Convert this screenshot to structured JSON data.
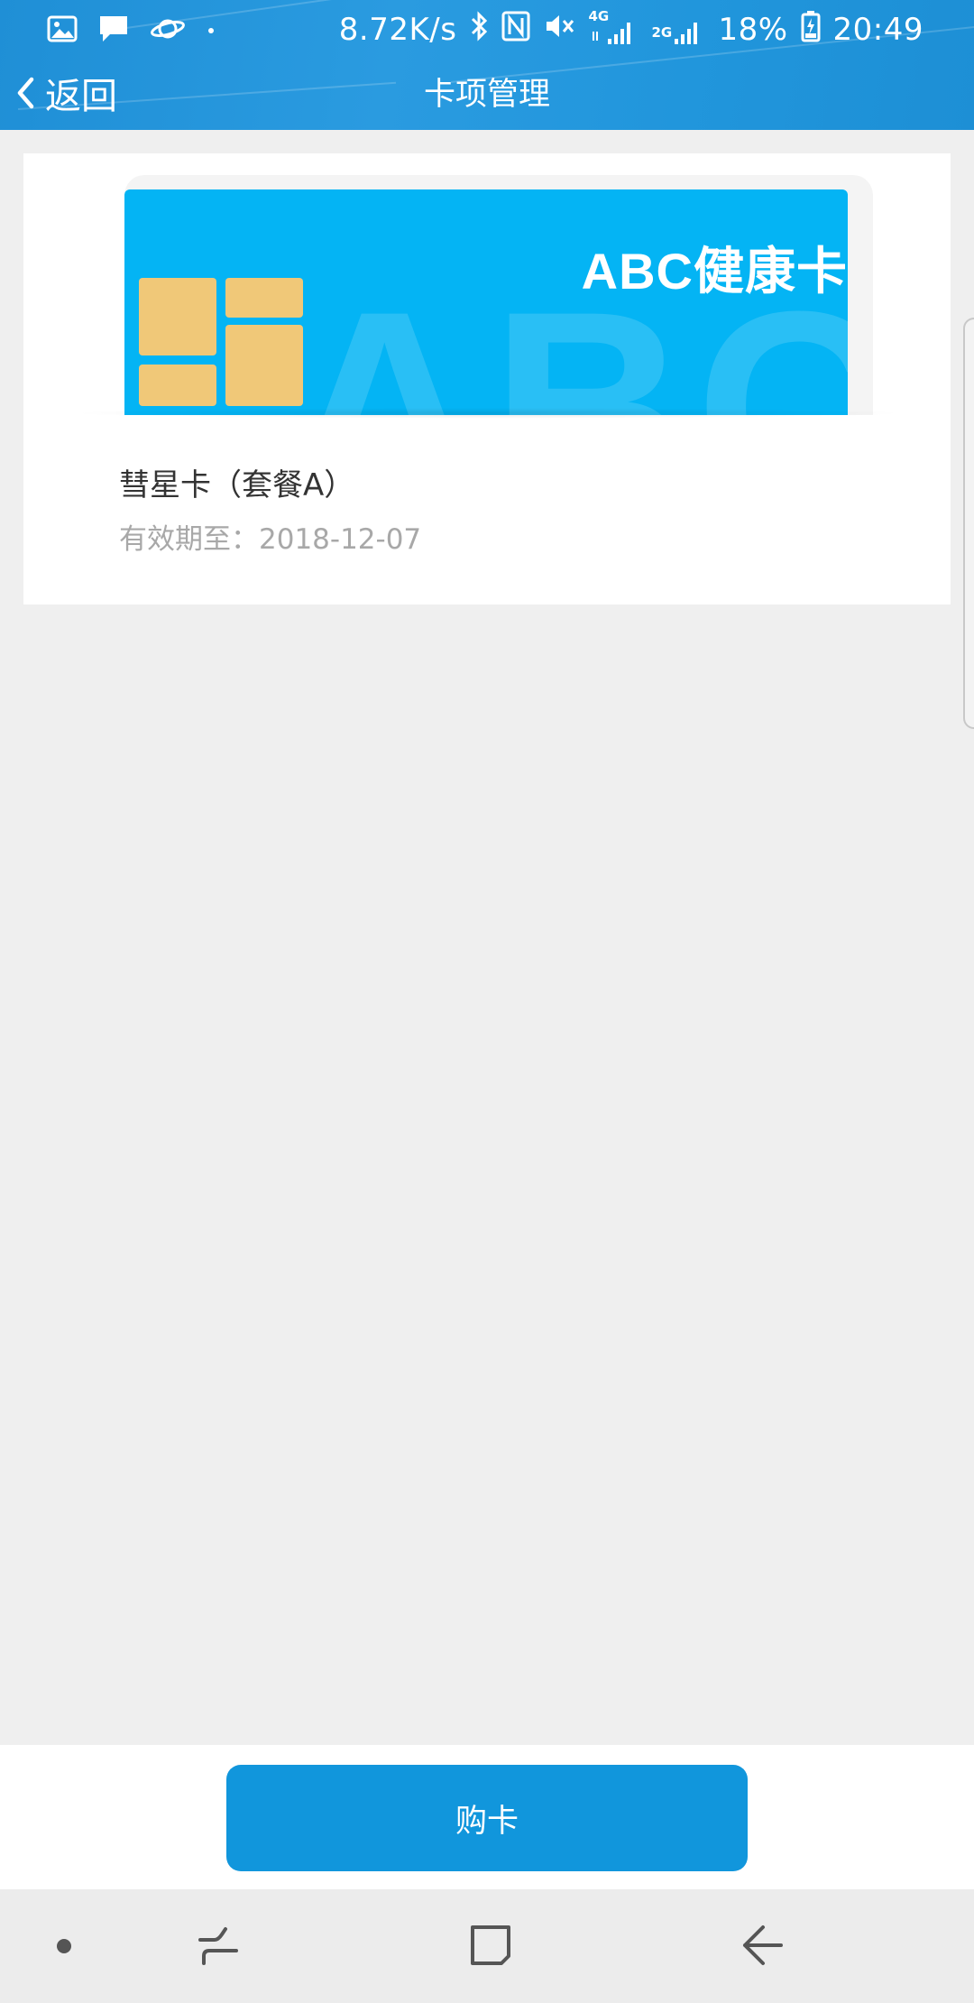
{
  "status_bar": {
    "network_speed": "8.72K/s",
    "network_4g": "4G",
    "network_2g": "2G",
    "battery_percent": "18%",
    "time": "20:49",
    "left_icons": [
      "gallery-notification-icon",
      "message-notification-icon",
      "planet-app-icon",
      "dot-icon"
    ],
    "right_icons": [
      "bluetooth-icon",
      "nfc-icon",
      "mute-icon",
      "signal-4g-icon",
      "signal-2g-icon",
      "battery-icon"
    ]
  },
  "title_bar": {
    "back_label": "返回",
    "title": "卡项管理"
  },
  "card": {
    "brand_text": "ABC健康卡",
    "watermark_text": "ABC",
    "name": "彗星卡（套餐A）",
    "expiry": "有效期至：2018-12-07"
  },
  "actions": {
    "buy_label": "购卡"
  },
  "nav_bar": {
    "items": [
      "dot-icon",
      "recent-apps-icon",
      "home-icon",
      "back-icon"
    ]
  },
  "colors": {
    "header": "#1f8fd6",
    "card_face": "#04b4f4",
    "chip": "#f0c878",
    "button": "#1196dc",
    "background": "#efefef"
  }
}
